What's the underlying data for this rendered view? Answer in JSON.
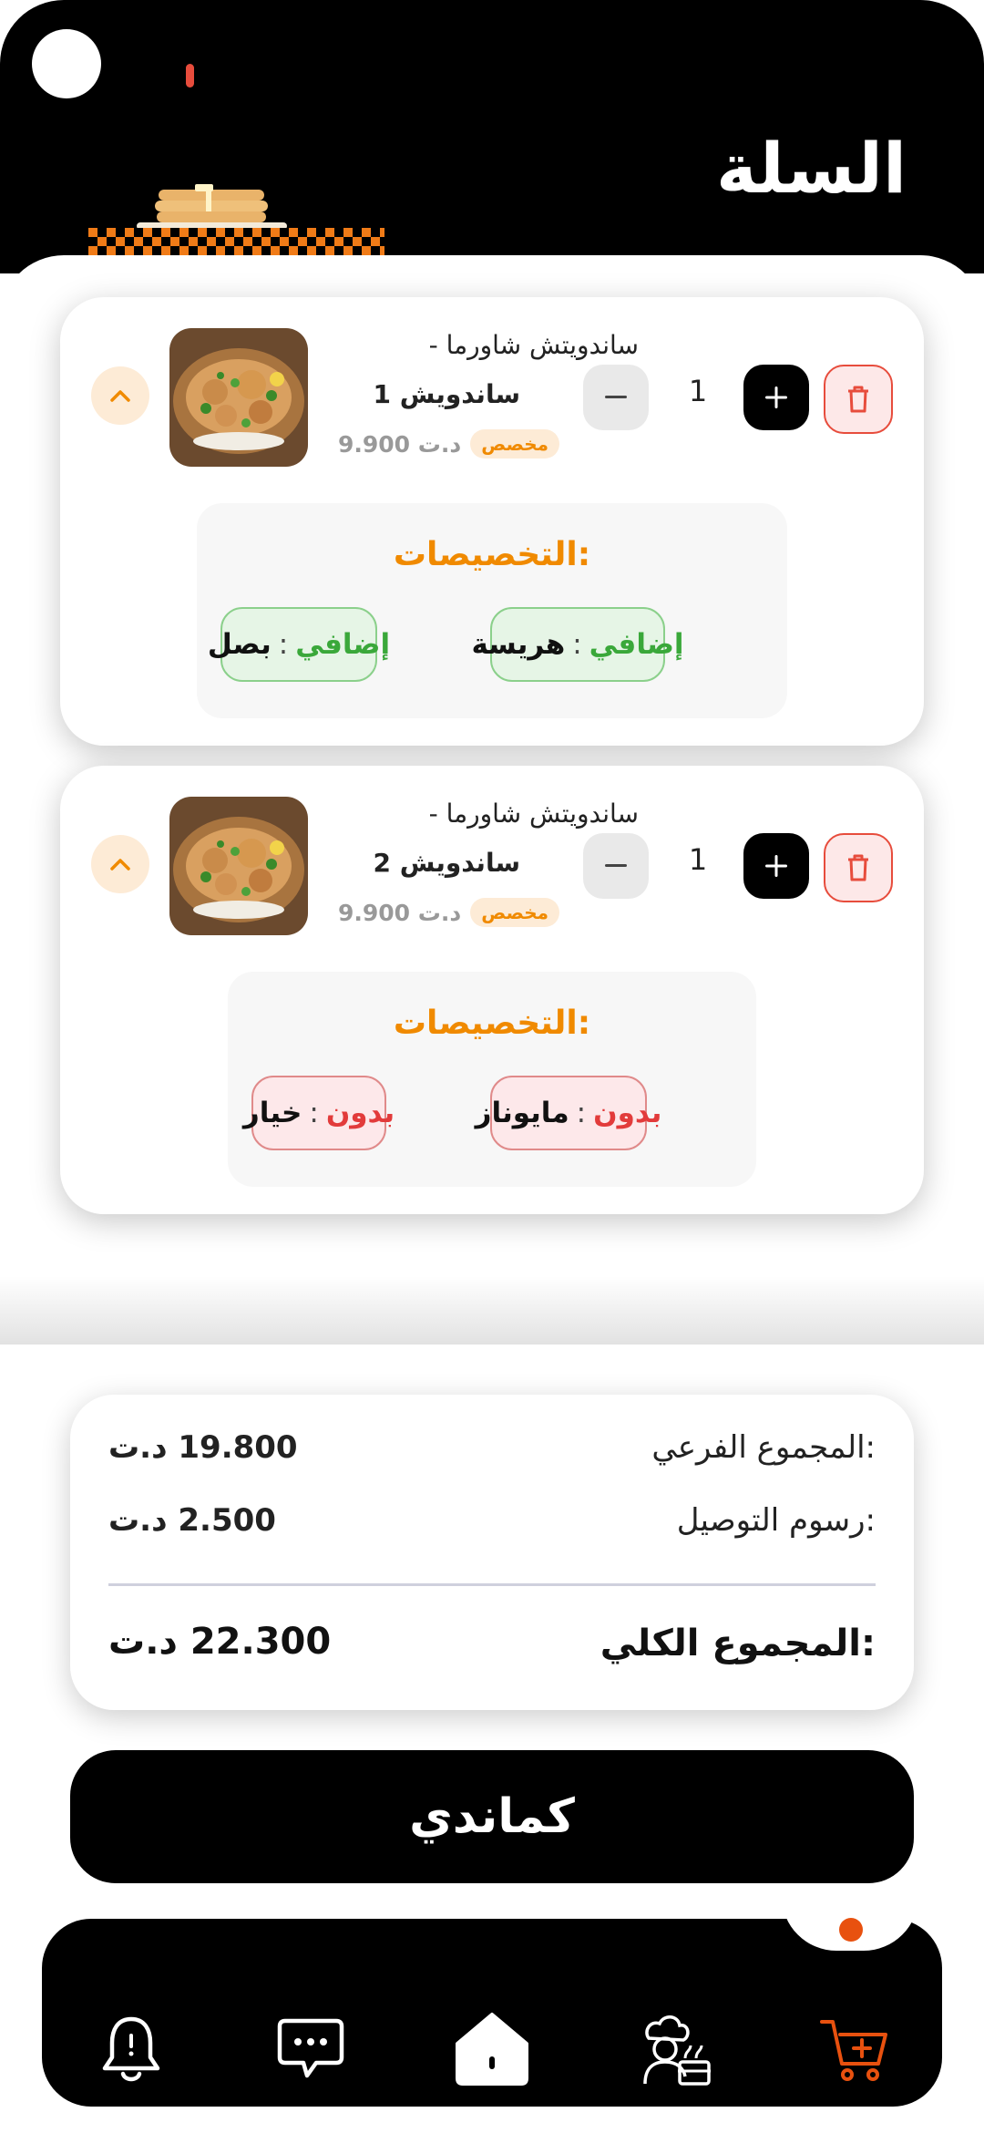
{
  "header": {
    "title": "السلة"
  },
  "currency": "د.ت",
  "cart_items": [
    {
      "name_line1": "ساندويتش شاورما -",
      "name_line2": "ساندويش 1",
      "price": "9.900 د.ت",
      "badge": "مخصص",
      "quantity": "1",
      "customizations_title": ":التخصيصات",
      "chips": [
        {
          "kind": "إضافي",
          "sep": ":",
          "value": "هريسة"
        },
        {
          "kind": "إضافي",
          "sep": ":",
          "value": "بصل"
        }
      ]
    },
    {
      "name_line1": "ساندويتش شاورما -",
      "name_line2": "ساندويش 2",
      "price": "9.900 د.ت",
      "badge": "مخصص",
      "quantity": "1",
      "customizations_title": ":التخصيصات",
      "chips": [
        {
          "kind": "بدون",
          "sep": ":",
          "value": "مايوناز"
        },
        {
          "kind": "بدون",
          "sep": ":",
          "value": "خيار"
        }
      ]
    }
  ],
  "summary": {
    "subtotal_label": ":المجموع الفرعي",
    "subtotal_value": "19.800 د.ت",
    "delivery_label": ":رسوم التوصيل",
    "delivery_value": "2.500 د.ت",
    "total_label": ":المجموع الكلي",
    "total_value": "22.300 د.ت"
  },
  "order_button": {
    "label": "كماندي"
  },
  "nav": {
    "items": [
      {
        "icon": "bell-icon"
      },
      {
        "icon": "chat-icon"
      },
      {
        "icon": "home-icon"
      },
      {
        "icon": "chef-icon"
      },
      {
        "icon": "cart-add-icon",
        "active": true
      }
    ],
    "accent": "#e8510f"
  },
  "colors": {
    "accent": "#f08a00",
    "add": "#3aa83a",
    "remove": "#e23b3b",
    "danger": "#e74c3c"
  }
}
